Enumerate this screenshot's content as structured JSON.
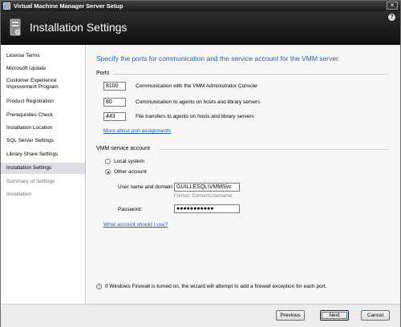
{
  "window": {
    "title": "Virtual Machine Manager Server Setup",
    "close_glyph": "×"
  },
  "header": {
    "title": "Installation Settings",
    "help_glyph": "?"
  },
  "sidebar": {
    "items": [
      {
        "label": "License Terms",
        "state": "done"
      },
      {
        "label": "Microsoft Update",
        "state": "done"
      },
      {
        "label": "Customer Experience Improvement Program",
        "state": "done"
      },
      {
        "label": "Product Registration",
        "state": "done"
      },
      {
        "label": "Prerequisites Check",
        "state": "done"
      },
      {
        "label": "Installation Location",
        "state": "done"
      },
      {
        "label": "SQL Server Settings",
        "state": "done"
      },
      {
        "label": "Library Share Settings",
        "state": "done"
      },
      {
        "label": "Installation Settings",
        "state": "active"
      },
      {
        "label": "Summary of Settings",
        "state": "pending"
      },
      {
        "label": "Installation",
        "state": "pending"
      }
    ]
  },
  "main": {
    "intro": "Specify the ports for communication and the service account for the VMM server.",
    "ports": {
      "label": "Ports",
      "items": [
        {
          "value": "8100",
          "description": "Communication with the VMM Administrator Console"
        },
        {
          "value": "80",
          "description": "Communication to agents on hosts and library servers"
        },
        {
          "value": "443",
          "description": "File transfers to agents on hosts and library servers"
        }
      ],
      "more_link": "More about port assignments"
    },
    "account": {
      "label": "VMM service account",
      "local_system": "Local system",
      "other_account": "Other account",
      "selected": "other_account",
      "username_label": "User name and domain:",
      "username_value": "GUILLESQL\\VMMSvc",
      "username_hint": "Format: Domain\\Username",
      "password_label": "Password:",
      "password_value": "●●●●●●●●●●●",
      "what_account_link": "What account should I use?"
    },
    "info_icon": "i",
    "info": "If Windows Firewall is turned on, the wizard will attempt to add a firewall exception for each port."
  },
  "footer": {
    "previous": "Previous",
    "next": "Next",
    "cancel": "Cancel"
  }
}
